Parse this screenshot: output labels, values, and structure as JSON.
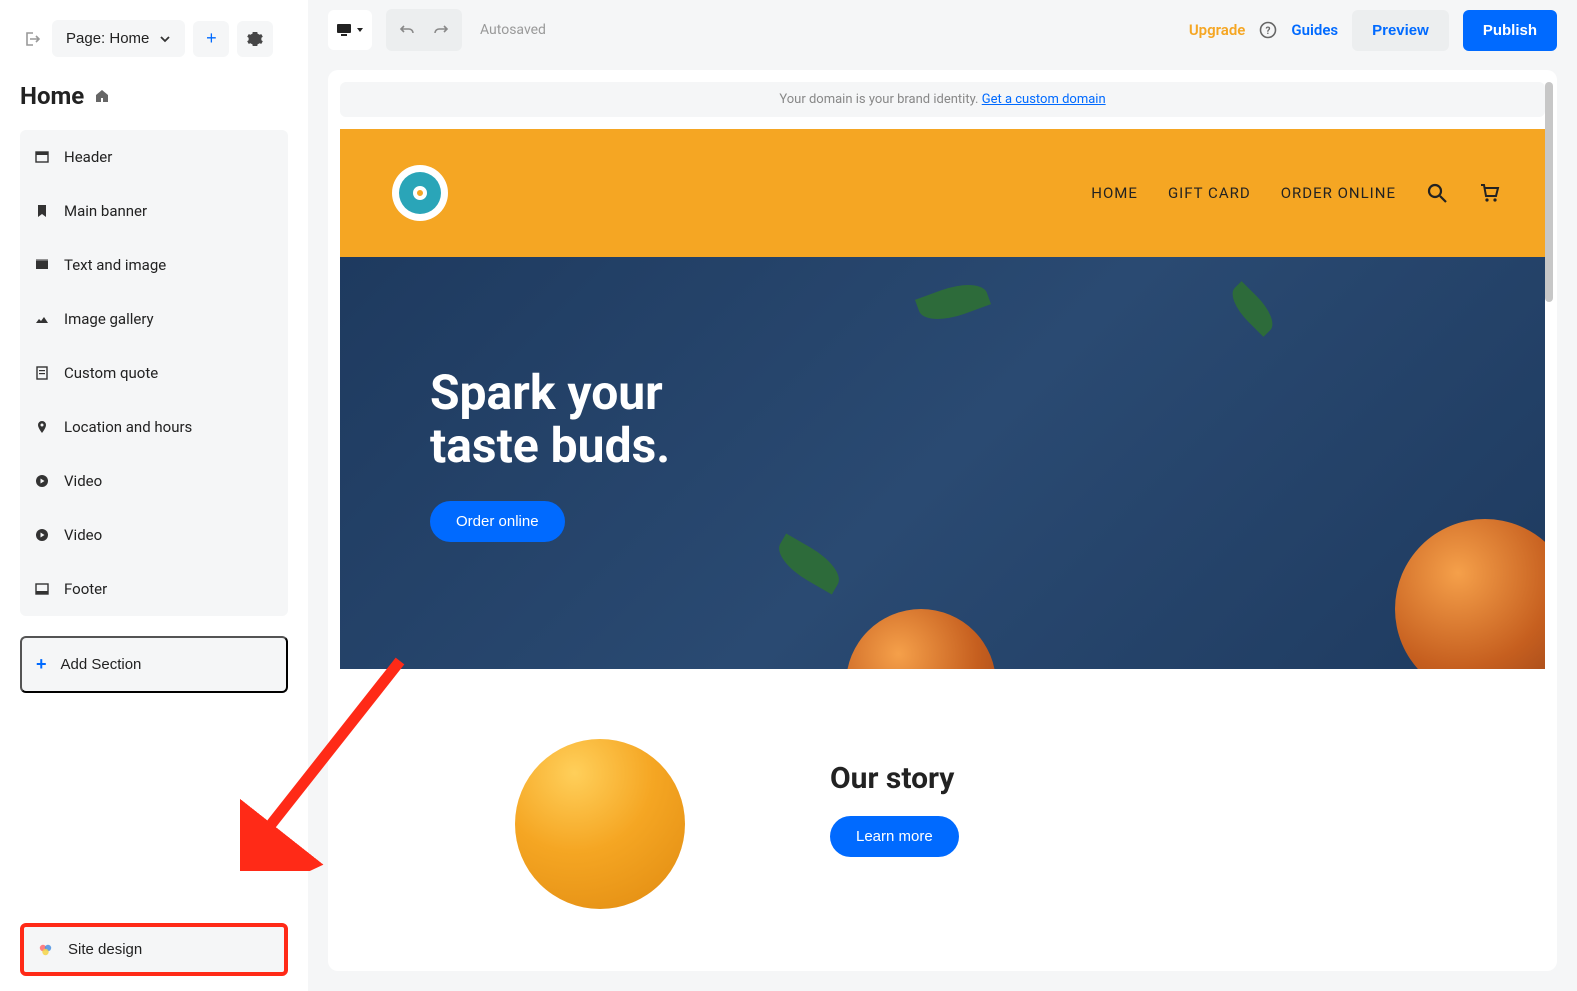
{
  "sidebar": {
    "page_selector": "Page: Home",
    "page_title": "Home",
    "sections": [
      {
        "label": "Header",
        "icon": "header-icon"
      },
      {
        "label": "Main banner",
        "icon": "bookmark-icon"
      },
      {
        "label": "Text and image",
        "icon": "text-image-icon"
      },
      {
        "label": "Image gallery",
        "icon": "gallery-icon"
      },
      {
        "label": "Custom quote",
        "icon": "quote-icon"
      },
      {
        "label": "Location and hours",
        "icon": "pin-icon"
      },
      {
        "label": "Video",
        "icon": "play-icon"
      },
      {
        "label": "Video",
        "icon": "play-icon"
      },
      {
        "label": "Footer",
        "icon": "footer-icon"
      }
    ],
    "add_section": "Add Section",
    "site_design": "Site design"
  },
  "toolbar": {
    "autosaved": "Autosaved",
    "upgrade": "Upgrade",
    "guides": "Guides",
    "preview": "Preview",
    "publish": "Publish"
  },
  "preview": {
    "domain_banner_text": "Your domain is your brand identity. ",
    "domain_banner_link": "Get a custom domain",
    "nav": [
      {
        "label": "HOME"
      },
      {
        "label": "GIFT CARD"
      },
      {
        "label": "ORDER ONLINE"
      }
    ],
    "hero_line1": "Spark your",
    "hero_line2": "taste buds.",
    "hero_cta": "Order online",
    "story_title": "Our story",
    "story_cta": "Learn more"
  }
}
